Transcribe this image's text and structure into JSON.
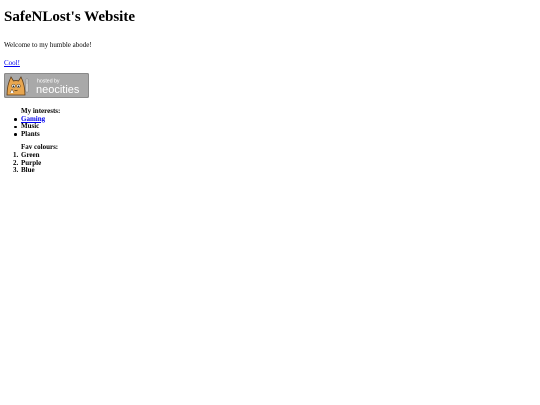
{
  "page": {
    "title": "SafeNLost's Website",
    "welcome": "Welcome to my humble abode!",
    "cool_link": "Cool!"
  },
  "badge": {
    "text_small": "hosted by",
    "text_large": "neocities",
    "colors": {
      "background": "#a9a9a9",
      "text": "#ffffff",
      "cat": "#e8a64f"
    }
  },
  "interests": {
    "title": "My interests:",
    "items": [
      "Gaming",
      "Music",
      "Plants"
    ]
  },
  "colours": {
    "title": "Fav colours:",
    "numbers": [
      "1.",
      "2.",
      "3."
    ],
    "items": [
      "Green",
      "Purple",
      "Blue"
    ]
  }
}
